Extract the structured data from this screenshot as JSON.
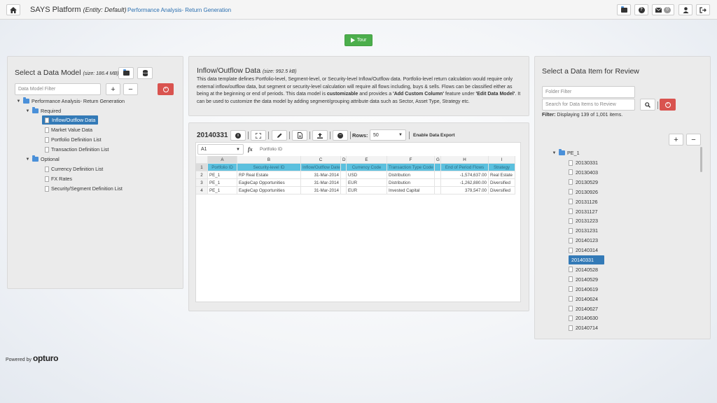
{
  "header": {
    "app_title": "SAYS Platform",
    "entity_label": "(Entity: Default)",
    "breadcrumb": "Performance Analysis- Return Generation",
    "mail_count": "0",
    "home_icon": "home-icon",
    "icons": [
      "folder-icon",
      "help-icon",
      "mail-icon",
      "user-icon",
      "logout-icon"
    ]
  },
  "tour": {
    "label": "Tour"
  },
  "left_panel": {
    "title": "Select a Data Model",
    "size": "(size: 186.4 MB)",
    "filter_placeholder": "Data Model Filter",
    "tree": {
      "root": "Performance Analysis- Return Generation",
      "required_label": "Required",
      "required_items": [
        "Inflow/Outflow Data",
        "Market Value Data",
        "Portfolio Definition List",
        "Transaction Definition List"
      ],
      "optional_label": "Optional",
      "optional_items": [
        "Currency Definition List",
        "FX Rates",
        "Security/Segment Definition List"
      ]
    }
  },
  "info_panel": {
    "title": "Inflow/Outflow Data",
    "size": "(size: 992.5 kB)",
    "desc_1": "This data template defines Portfolio-level, Segment-level, or Security-level Inflow/Outflow data. Portfolio-level return calculation would require only external inflow/outflow data, but segment or security-level calculation will require all flows including, buys & sells. Flows can be classified either as being at the beginning or end of periods. This data model is ",
    "desc_bold_1": "customizable",
    "desc_2": " and provides a ",
    "desc_bold_2": "'Add Custom Column'",
    "desc_3": " feature under ",
    "desc_bold_3": "'Edit Data Model'",
    "desc_4": ". It can be used to customize the data model by adding segment/grouping attribute data such as Sector, Asset Type, Strategy etc."
  },
  "sheet_panel": {
    "date": "20140331",
    "rows_label": "Rows:",
    "rows_value": "50",
    "export_label": "Enable Data Export",
    "cell_ref": "A1",
    "fx_label": "fx",
    "formula_value": "Portfolio ID",
    "col_letters": [
      "A",
      "B",
      "C",
      "D",
      "E",
      "F",
      "G",
      "H",
      "I"
    ],
    "row_numbers": [
      "1",
      "2",
      "3",
      "4"
    ],
    "header_row": [
      "Portfolio ID",
      "Security-level ID",
      "Inflow/Outflow Date",
      "",
      "Currency Code",
      "Transaction Type Code",
      "",
      "End of Period Flows",
      "Strategy"
    ],
    "rows": [
      [
        "PE_1",
        "RP Real Estate",
        "31-Mar-2014",
        "",
        "USD",
        "Distribution",
        "",
        "-1,574,637.00",
        "Real Estate"
      ],
      [
        "PE_1",
        "EagleCap Opportunities",
        "31-Mar-2014",
        "",
        "EUR",
        "Distribution",
        "",
        "-1,262,880.00",
        "Diversified"
      ],
      [
        "PE_1",
        "EagleCap Opportunities",
        "31-Mar-2014",
        "",
        "EUR",
        "Invested Capital",
        "",
        "379,547.00",
        "Diversified"
      ]
    ]
  },
  "right_panel": {
    "title": "Select a Data Item for Review",
    "folder_filter_placeholder": "Folder Filter",
    "search_placeholder": "Search for Data Items to Review",
    "filter_label": "Filter:",
    "filter_text": "Displaying 139 of 1,001 items.",
    "root": "PE_1",
    "items": [
      "20130331",
      "20130403",
      "20130529",
      "20130926",
      "20131126",
      "20131127",
      "20131223",
      "20131231",
      "20140123",
      "20140314",
      "20140331",
      "20140528",
      "20140529",
      "20140619",
      "20140624",
      "20140627",
      "20140630",
      "20140714"
    ],
    "selected": "20140331"
  },
  "footer": {
    "powered_by": "Powered by",
    "brand": "opturo"
  },
  "colors": {
    "accent": "#337ab7",
    "danger": "#d9534f",
    "success": "#4cae4c",
    "sheet_header": "#5bc0de"
  }
}
